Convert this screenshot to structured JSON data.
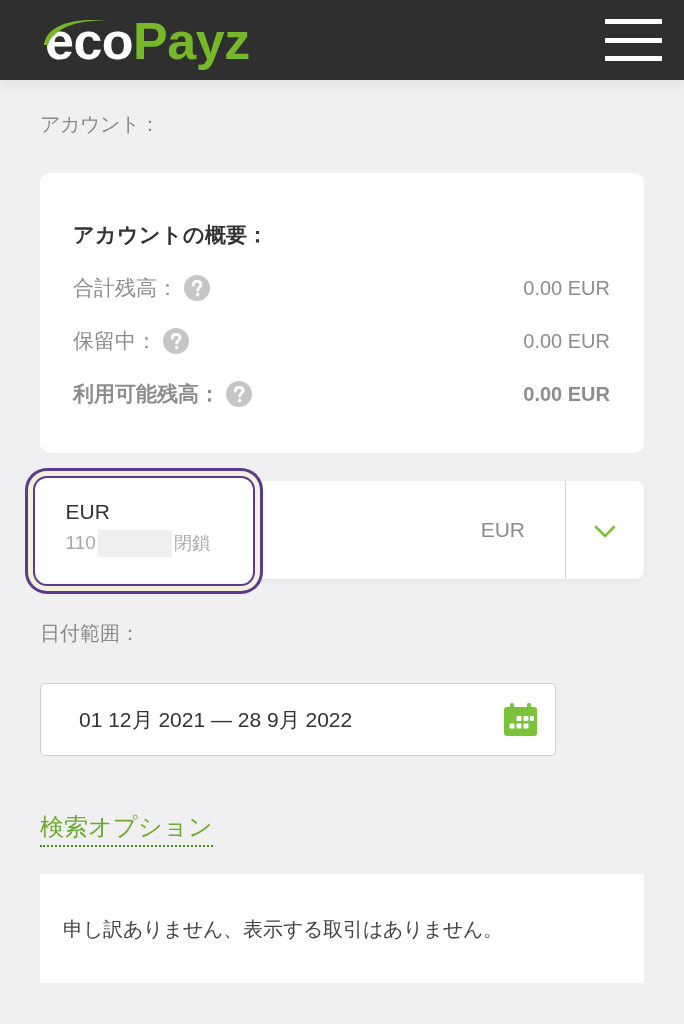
{
  "header": {
    "logo": {
      "prefix": "eco",
      "brand": "Payz"
    }
  },
  "account_label": "アカウント：",
  "summary": {
    "title": "アカウントの概要：",
    "rows": [
      {
        "label": "合計残高：",
        "value": "0.00 EUR",
        "bold": false
      },
      {
        "label": "保留中：",
        "value": "0.00 EUR",
        "bold": false
      },
      {
        "label": "利用可能残高：",
        "value": "0.00 EUR",
        "bold": true
      }
    ]
  },
  "account_selector": {
    "name": "EUR",
    "number_prefix": "110",
    "status": "閉鎖",
    "currency": "EUR",
    "highlighted": true
  },
  "date_range": {
    "label": "日付範囲：",
    "value": "01 12月 2021 — 28 9月 2022"
  },
  "search_options_link": "検索オプション",
  "message": "申し訳ありません、表示する取引はありません。"
}
